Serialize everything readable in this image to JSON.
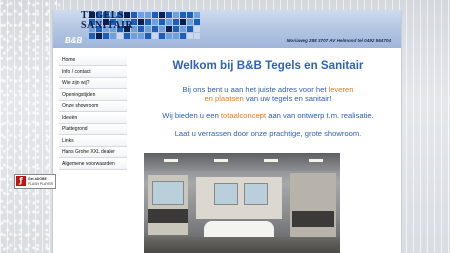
{
  "header": {
    "logo_line1": "TEGELS",
    "logo_line2": "SANITAIR",
    "logo_mark": "B&B",
    "address": "Moriaweg 288 3707 AV Helmond tel 0492 564704",
    "brand_colors": [
      "#0b1f4e",
      "#1d5fb8",
      "#6fa0dc",
      "#c9d8ee"
    ]
  },
  "sidebar": {
    "items": [
      {
        "label": "Home"
      },
      {
        "label": "Info / contact"
      },
      {
        "label": "Wie zijn wij?"
      },
      {
        "label": "Openingstijden"
      },
      {
        "label": "Onze showroom"
      },
      {
        "label": "Ideeën"
      },
      {
        "label": "Plattegrond"
      },
      {
        "label": "Links"
      },
      {
        "label": "Hans Grohe XXL dealer"
      },
      {
        "label": "Algemene voorwaarden"
      }
    ],
    "badge": {
      "icon": "flash-player-icon",
      "line1": "Get ADOBE",
      "line2": "FLASH PLAYER"
    }
  },
  "main": {
    "title": "Welkom bij B&B Tegels en Sanitair",
    "intro_a": "Bij ons bent u aan het juiste adres voor het",
    "intro_hl1": "leveren",
    "intro_hl2": "en plaatsen",
    "intro_b": "van uw tegels en sanitair!",
    "concept_a": "Wij bieden u een",
    "concept_hl": "totaalconcept",
    "concept_b": "aan van ontwerp t.m. realisatie.",
    "invite": "Laat u verrassen door onze prachtige, grote showroom.",
    "text_color": "#2e5fb5",
    "highlight_color": "#f07c1a"
  }
}
